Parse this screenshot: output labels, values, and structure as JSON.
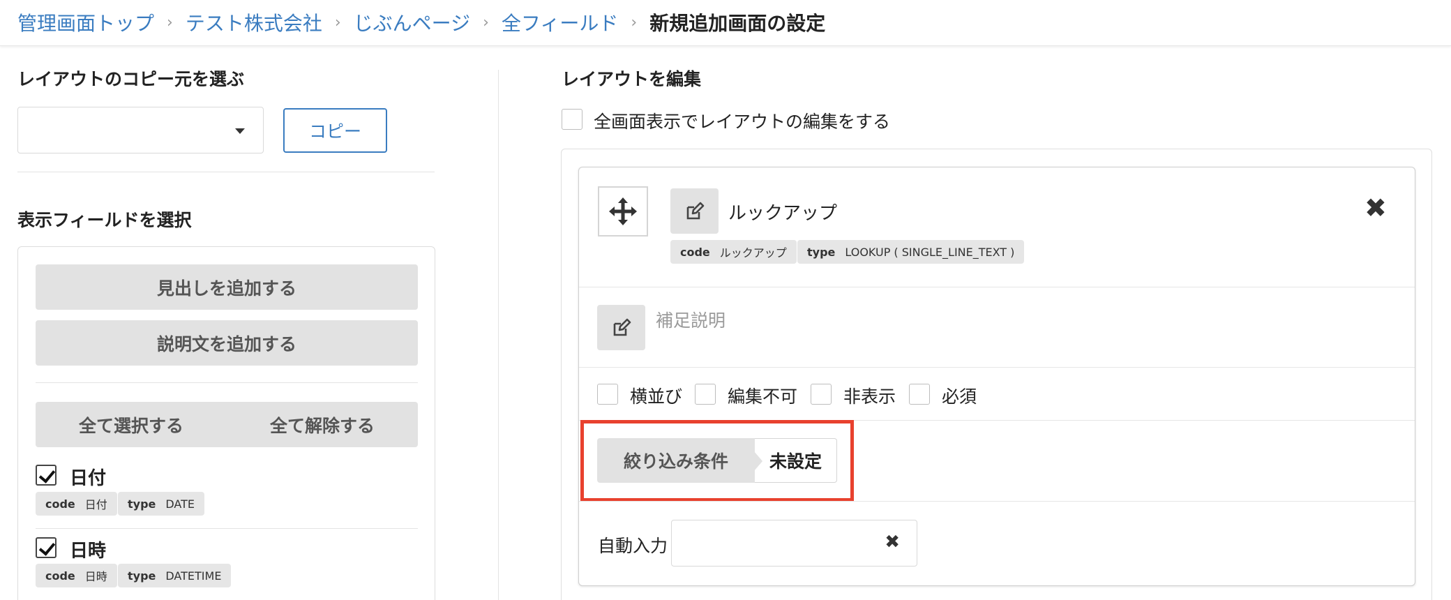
{
  "breadcrumb": {
    "items": [
      "管理画面トップ",
      "テスト株式会社",
      "じぶんページ",
      "全フィールド"
    ],
    "current": "新規追加画面の設定",
    "separator": "›"
  },
  "left": {
    "copy_title": "レイアウトのコピー元を選ぶ",
    "copy_button": "コピー",
    "fields_title": "表示フィールドを選択",
    "add_heading": "見出しを追加する",
    "add_description": "説明文を追加する",
    "select_all": "全て選択する",
    "deselect_all": "全て解除する",
    "fields": [
      {
        "name": "日付",
        "code_key": "code",
        "code": "日付",
        "type_key": "type",
        "type": "DATE",
        "checked": true
      },
      {
        "name": "日時",
        "code_key": "code",
        "code": "日時",
        "type_key": "type",
        "type": "DATETIME",
        "checked": true
      }
    ]
  },
  "right": {
    "title": "レイアウトを編集",
    "fullscreen_label": "全画面表示でレイアウトの編集をする",
    "card": {
      "field_title": "ルックアップ",
      "code_key": "code",
      "code": "ルックアップ",
      "type_key": "type",
      "type": "LOOKUP ( SINGLE_LINE_TEXT )",
      "close": "✖",
      "description_placeholder": "補足説明",
      "options": [
        "横並び",
        "編集不可",
        "非表示",
        "必須"
      ],
      "filter_label": "絞り込み条件",
      "filter_value": "未設定",
      "auto_label": "自動入力",
      "auto_clear": "✖"
    }
  },
  "colors": {
    "link": "#3a7cc0",
    "highlight": "#e8412e",
    "button_gray": "#e2e2e2"
  },
  "icons": {
    "move": "move-arrows-icon",
    "edit": "edit-pencil-icon",
    "dropdown": "caret-down-icon",
    "check": "checkmark-icon",
    "close": "close-icon"
  }
}
